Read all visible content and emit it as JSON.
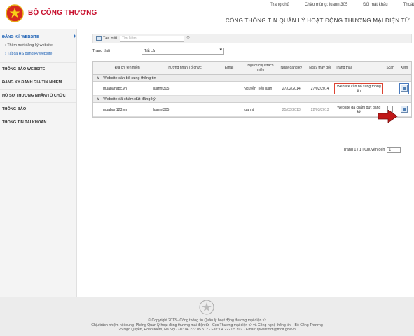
{
  "header": {
    "brand": "BỘ CÔNG THƯƠNG",
    "nav": [
      "Trang chủ",
      "Chào mừng:",
      "Đổi mật khẩu",
      "Thoát"
    ],
    "username": "luannt305",
    "subtitle": "CỔNG THÔNG TIN QUẢN LÝ HOẠT ĐỘNG THƯƠNG MẠI ĐIỆN TỬ"
  },
  "sidebar": {
    "section_title": "ĐĂNG KÝ WEBSITE",
    "sub_items": [
      "Thêm mới đăng ký website",
      "Tất cả HS đăng ký website"
    ],
    "items": [
      "THÔNG BÁO WEBSITE",
      "ĐĂNG KÝ ĐÁNH GIÁ TÍN NHIỆM",
      "HỒ SƠ THƯƠNG NHÂN/TỔ CHỨC",
      "THÔNG BÁO",
      "THÔNG TIN TÀI KHOẢN"
    ]
  },
  "toolbar": {
    "create_label": "Tạo mới",
    "search_placeholder": "Tìm kiếm"
  },
  "filter": {
    "label": "Trạng thái",
    "value": "Tất cả"
  },
  "table": {
    "headers": [
      "Địa chỉ tên miền",
      "Thương nhân/Tổ chức",
      "Email",
      "Người chịu trách nhiệm",
      "Ngày đăng ký",
      "Ngày thay đổi",
      "Trạng thái",
      "Scan",
      "Xem"
    ],
    "groups": [
      {
        "label": "Website cần bổ sung thông tin",
        "rows": [
          {
            "domain": "muabanabc.vn",
            "org": "luannt305",
            "email": "",
            "person": "Nguyễn Tiến luận",
            "reg_date": "27/02/2014",
            "mod_date": "27/02/2014",
            "status": "Website cần bổ sung thông tin"
          }
        ]
      },
      {
        "label": "Website đã chấm dứt đăng ký",
        "rows": [
          {
            "domain": "muaban123.vn",
            "org": "luannt305",
            "email": "",
            "person": "luannt",
            "reg_date": "25/03/2013",
            "mod_date": "22/03/2013",
            "status": "Website đã chấm dứt đăng ký"
          }
        ]
      }
    ]
  },
  "pager": {
    "text": "Trang 1 / 1 | Chuyển đến",
    "page": "1"
  },
  "footer": {
    "line1": "© Copyright 2013 - Cổng thông tin Quản lý hoạt động thương mại điện tử",
    "line2": "Chịu trách nhiệm nội dung: Phòng Quản lý hoạt động thương mại điện tử - Cục Thương mại điện tử và Công nghệ thông tin – Bộ Công Thương",
    "line3": "25 Ngô Quyền, Hoàn Kiếm, Hà Nội - ĐT: 04 222 05 512 - Fax: 04 222 05 397 - Email: qlwebtmdt@moit.gov.vn"
  }
}
